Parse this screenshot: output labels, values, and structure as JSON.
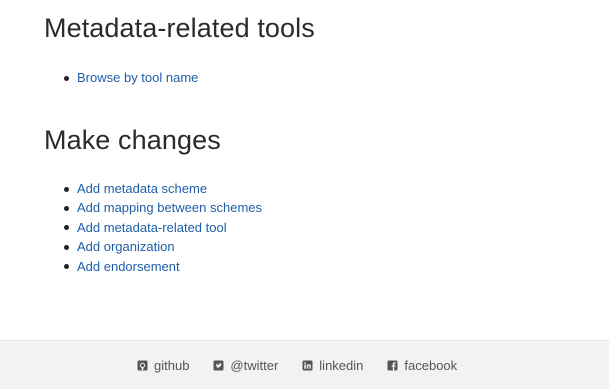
{
  "sections": [
    {
      "title": "Metadata-related tools",
      "links": [
        {
          "label": "Browse by tool name"
        }
      ]
    },
    {
      "title": "Make changes",
      "links": [
        {
          "label": "Add metadata scheme"
        },
        {
          "label": "Add mapping between schemes"
        },
        {
          "label": "Add metadata-related tool"
        },
        {
          "label": "Add organization"
        },
        {
          "label": "Add endorsement"
        }
      ]
    }
  ],
  "footer": {
    "links": [
      {
        "label": "github",
        "icon": "github-icon"
      },
      {
        "label": "@twitter",
        "icon": "twitter-icon"
      },
      {
        "label": "linkedin",
        "icon": "linkedin-icon"
      },
      {
        "label": "facebook",
        "icon": "facebook-icon"
      }
    ]
  },
  "colors": {
    "link": "#1f5ea8",
    "heading": "#2b2b2b",
    "footer_bg": "#f2f2f2",
    "footer_text": "#555555"
  }
}
